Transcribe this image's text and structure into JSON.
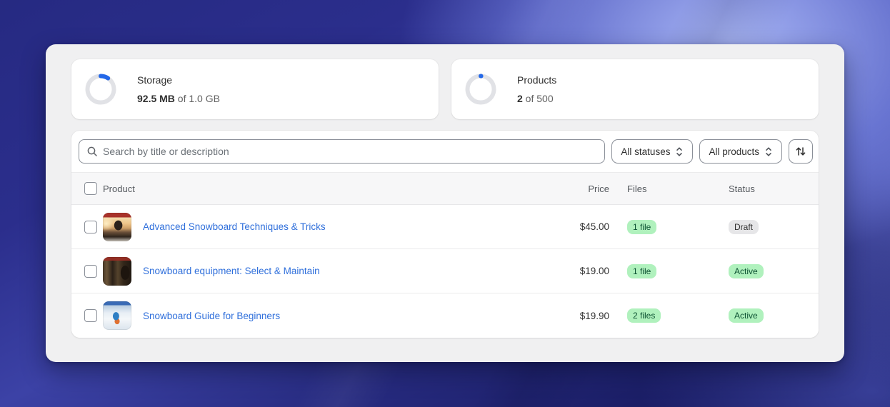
{
  "stats": [
    {
      "label": "Storage",
      "value": "92.5 MB",
      "suffix": " of 1.0 GB",
      "percent": 9.25
    },
    {
      "label": "Products",
      "value": "2",
      "suffix": " of 500",
      "percent": 0.4
    }
  ],
  "toolbar": {
    "search_placeholder": "Search by title or description",
    "status_filter_label": "All statuses",
    "product_filter_label": "All products"
  },
  "table": {
    "columns": {
      "product": "Product",
      "price": "Price",
      "files": "Files",
      "status": "Status"
    },
    "rows": [
      {
        "title": "Advanced Snowboard Techniques & Tricks",
        "price": "$45.00",
        "files": "1 file",
        "status": "Draft",
        "status_tone": "neutral"
      },
      {
        "title": "Snowboard equipment: Select & Maintain",
        "price": "$19.00",
        "files": "1 file",
        "status": "Active",
        "status_tone": "success"
      },
      {
        "title": "Snowboard Guide for Beginners",
        "price": "$19.90",
        "files": "2 files",
        "status": "Active",
        "status_tone": "success"
      }
    ]
  },
  "colors": {
    "ring_track": "#e1e2e6",
    "ring_progress": "#2468e8",
    "link_blue": "#2f6fdb",
    "badge_success_bg": "#b0f1bd",
    "badge_success_text": "#0c5132",
    "badge_neutral_bg": "#e6e6e8",
    "badge_neutral_text": "#303030"
  }
}
